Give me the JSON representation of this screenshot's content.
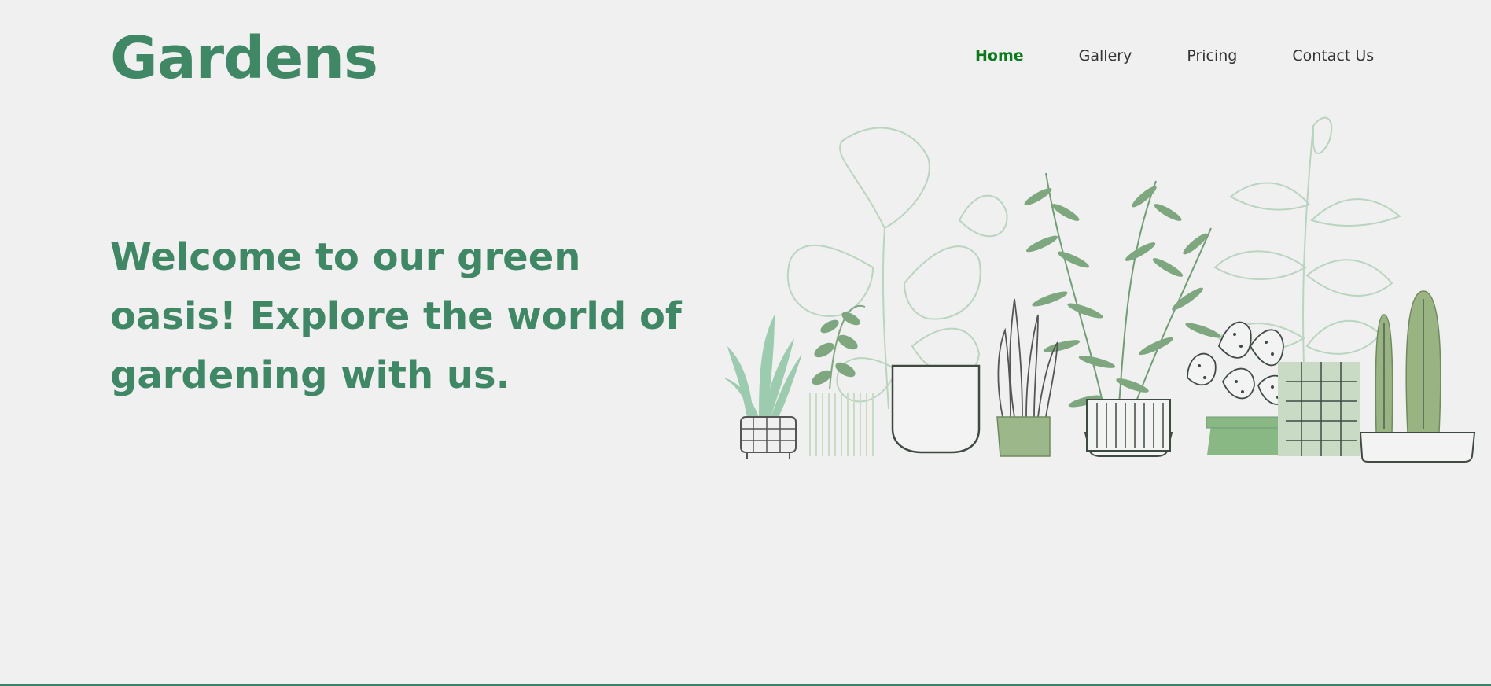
{
  "header": {
    "brand": "Gardens",
    "nav": [
      {
        "label": "Home",
        "active": true
      },
      {
        "label": "Gallery",
        "active": false
      },
      {
        "label": "Pricing",
        "active": false
      },
      {
        "label": "Contact Us",
        "active": false
      }
    ]
  },
  "hero": {
    "headline": "Welcome to our green oasis! Explore the world of gardening with us."
  },
  "illustration": {
    "icon": "potted-plants-illustration"
  },
  "colors": {
    "brand": "#408766",
    "nav_active": "#0c7a1c",
    "nav_text": "#333333",
    "background": "#f0f0f0",
    "bottom_border": "#3e7f6a"
  }
}
